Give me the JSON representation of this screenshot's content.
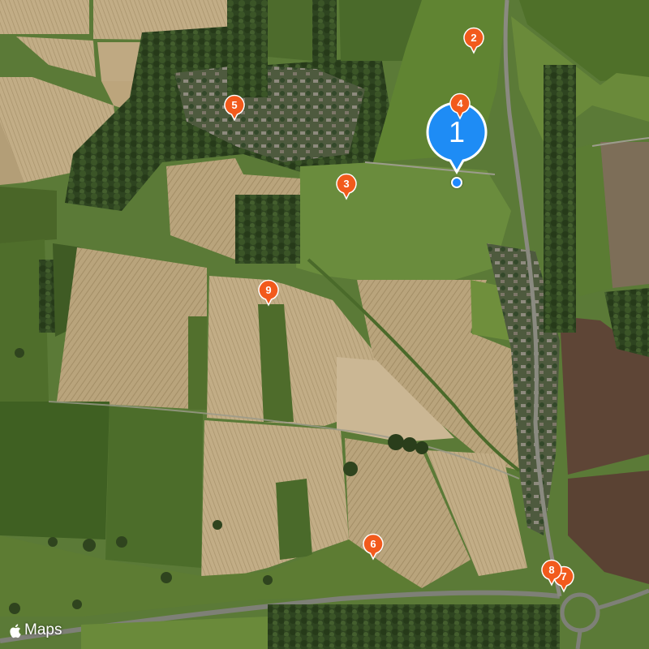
{
  "map": {
    "type": "satellite",
    "brand": {
      "icon": "apple-logo-icon",
      "label": "Maps"
    },
    "pin_color": "#f25a1c",
    "selected_pin_color": "#1e8cf5",
    "pins": [
      {
        "label": "1",
        "selected": true
      },
      {
        "label": "2"
      },
      {
        "label": "3"
      },
      {
        "label": "4"
      },
      {
        "label": "5"
      },
      {
        "label": "6"
      },
      {
        "label": "7"
      },
      {
        "label": "8"
      },
      {
        "label": "9"
      }
    ]
  }
}
